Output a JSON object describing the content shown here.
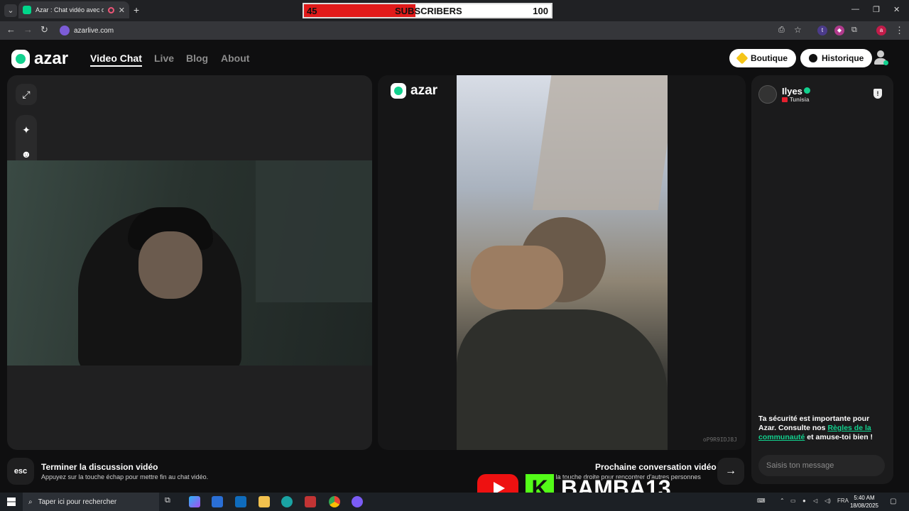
{
  "browser": {
    "tab_title": "Azar : Chat vidéo avec de n",
    "url": "azarlive.com"
  },
  "overlay": {
    "sub_current": "45",
    "sub_label": "SUBSCRIBERS",
    "sub_goal": "100",
    "sub_progress": 0.45,
    "streamer_name": "BAMBA13"
  },
  "site": {
    "logo_text": "azar",
    "nav": [
      "Video Chat",
      "Live",
      "Blog",
      "About"
    ],
    "shop_label": "Boutique",
    "history_label": "Historique"
  },
  "peer": {
    "code": "oP9R9IDJ8J"
  },
  "chat": {
    "username": "Ilyes",
    "country": "Tunisia",
    "safety_part1": "Ta sécurité est importante pour Azar. Consulte nos ",
    "safety_link": "Règles de la communauté",
    "safety_part2": " et amuse-toi bien !",
    "input_placeholder": "Saisis ton message"
  },
  "controls": {
    "esc_key": "esc",
    "end_title": "Terminer la discussion vidéo",
    "end_sub": "Appuyez sur la touche échap pour mettre fin au chat vidéo.",
    "next_title": "Prochaine conversation vidéo",
    "next_sub": "r la touche droite pour rencontrer d'autres personnes"
  },
  "taskbar": {
    "search_placeholder": "Taper ici pour rechercher",
    "lang": "FRA",
    "time": "5:40 AM",
    "date": "18/08/2025"
  },
  "colors": {
    "accent": "#12d18e",
    "background": "#0f0f10",
    "panel": "#202021"
  }
}
